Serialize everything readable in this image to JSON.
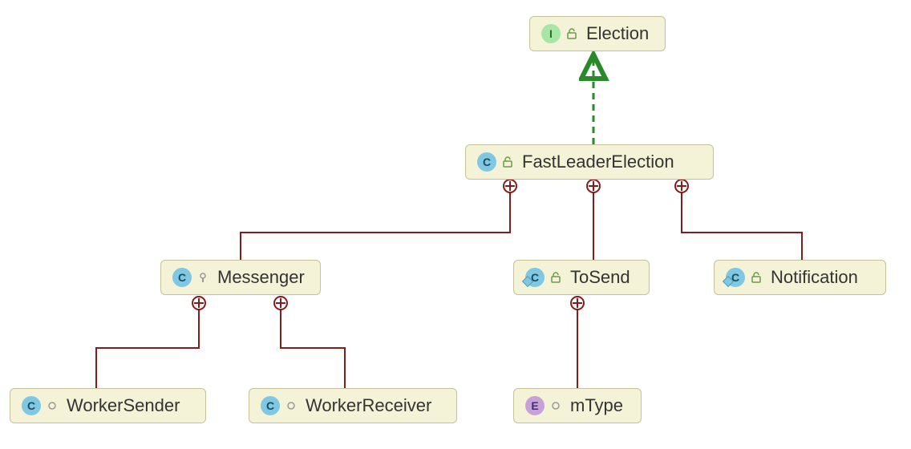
{
  "nodes": {
    "election": {
      "type": "I",
      "visibility": "public",
      "label": "Election",
      "static": false
    },
    "fastLeaderElection": {
      "type": "C",
      "visibility": "public",
      "label": "FastLeaderElection",
      "static": false
    },
    "messenger": {
      "type": "C",
      "visibility": "package",
      "label": "Messenger",
      "static": false
    },
    "toSend": {
      "type": "C",
      "visibility": "public",
      "label": "ToSend",
      "static": true
    },
    "notification": {
      "type": "C",
      "visibility": "public",
      "label": "Notification",
      "static": true
    },
    "workerSender": {
      "type": "C",
      "visibility": "default",
      "label": "WorkerSender",
      "static": false
    },
    "workerReceiver": {
      "type": "C",
      "visibility": "default",
      "label": "WorkerReceiver",
      "static": false
    },
    "mType": {
      "type": "E",
      "visibility": "default",
      "label": "mType",
      "static": false
    }
  },
  "colors": {
    "nodeBg": "#f5f3d7",
    "nodeBorder": "#c5c397",
    "arrowGreen": "#2a8a2a",
    "lineRed": "#8a1a1a"
  }
}
